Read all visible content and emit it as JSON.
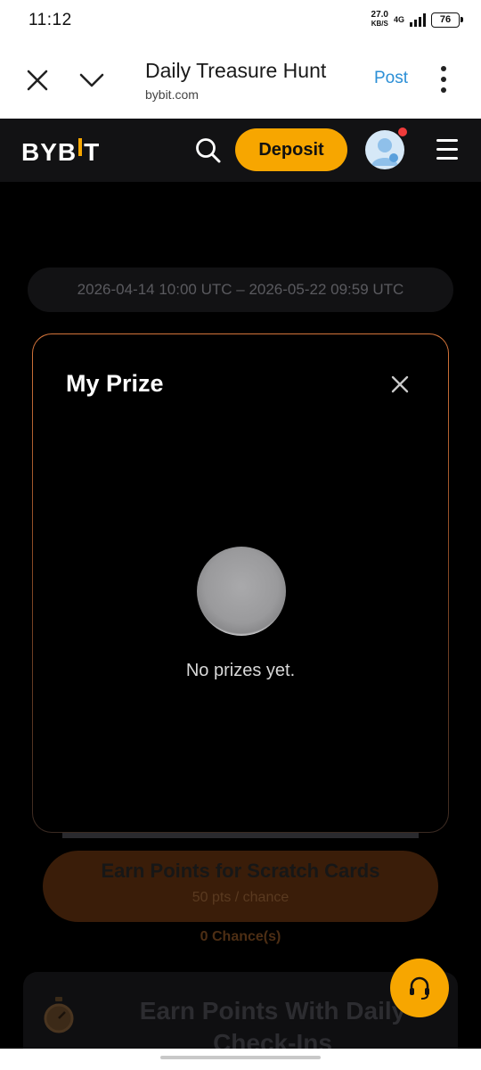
{
  "status_bar": {
    "time": "11:12",
    "net_speed": "27.0",
    "net_unit": "KB/S",
    "network": "4G",
    "battery": "76"
  },
  "browser": {
    "title": "Daily Treasure Hunt",
    "domain": "bybit.com",
    "post_label": "Post",
    "icons": [
      "close-icon",
      "chevron-down-icon",
      "more-vertical-icon"
    ]
  },
  "header": {
    "logo_left": "BYB",
    "logo_right": "T",
    "deposit_label": "Deposit",
    "accent_color": "#f7a600"
  },
  "background": {
    "date_range": "2026-04-14 10:00 UTC – 2026-05-22 09:59 UTC",
    "earn_title": "Earn Points for Scratch Cards",
    "earn_subtitle": "50 pts / chance",
    "chances": "0 Chance(s)",
    "checkin_title": "Earn Points With Daily Check-Ins"
  },
  "modal": {
    "title": "My Prize",
    "empty_text": "No prizes yet."
  }
}
